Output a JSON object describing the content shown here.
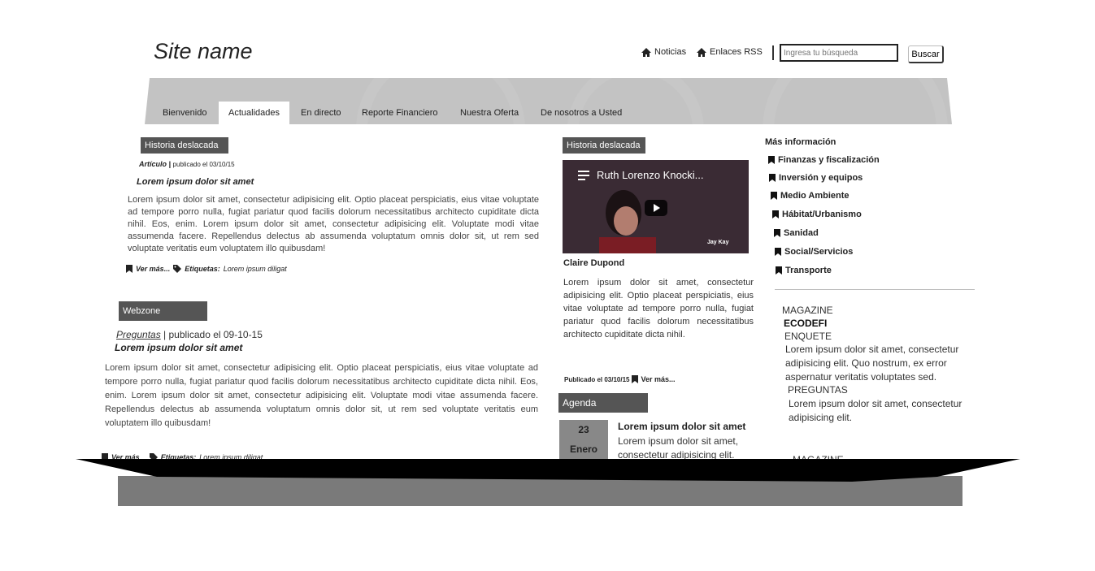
{
  "header": {
    "site_name": "Site name",
    "links": [
      {
        "label": "Noticias",
        "icon": "home-icon"
      },
      {
        "label": "Enlaces RSS",
        "icon": "home-icon"
      }
    ],
    "search": {
      "placeholder": "Ingresa tu búsqueda",
      "button_label": "Buscar"
    }
  },
  "nav": {
    "tabs": [
      {
        "label": "Bienvenido",
        "active": false
      },
      {
        "label": "Actualidades",
        "active": true
      },
      {
        "label": "En directo",
        "active": false
      },
      {
        "label": "Reporte Financiero",
        "active": false
      },
      {
        "label": "Nuestra Oferta",
        "active": false
      },
      {
        "label": "De nosotros a Usted",
        "active": false
      }
    ]
  },
  "featured_left": {
    "label": "Historia deslacada",
    "meta_type": "Artículo |",
    "meta_date": "publicado el 03/10/15",
    "title": "Lorem ipsum dolor sit amet",
    "body": "Lorem ipsum dolor sit amet, consectetur adipisicing elit. Optio placeat perspiciatis, eius vitae voluptate ad tempore porro nulla, fugiat pariatur quod facilis dolorum necessitatibus architecto cupiditate dicta nihil. Eos, enim. Lorem ipsum dolor sit amet, consectetur adipisicing elit. Voluptate modi vitae assumenda facere. Repellendus delectus ab assumenda voluptatum omnis dolor sit, ut rem sed voluptate veritatis eum voluptatem illo quibusdam!",
    "more": "Ver más...",
    "tags_label": "Etiquetas:",
    "tags": "Lorem ipsum diligat"
  },
  "webzone": {
    "label": "Webzone",
    "meta_link": "Preguntas",
    "meta_rest": " | publicado el 09-10-15",
    "title": "Lorem ipsum dolor sit amet",
    "body": "Lorem ipsum dolor sit amet, consectetur adipisicing elit. Optio placeat perspiciatis, eius vitae voluptate ad tempore porro nulla, fugiat pariatur quod facilis dolorum necessitatibus architecto cupiditate dicta nihil. Eos, enim. Lorem ipsum dolor sit amet, consectetur adipisicing elit. Voluptate modi vitae assumenda facere. Repellendus delectus ab assumenda voluptatum omnis dolor sit, ut rem sed voluptate veritatis eum voluptatem illo quibusdam!",
    "more": "Ver más",
    "tags_label": "Etiquetas:",
    "tags": "Lorem ipsum diligat"
  },
  "featured_mid": {
    "label": "Historia deslacada",
    "video_title": "Ruth Lorenzo Knocki...",
    "video_caption": "Jay Kay",
    "author": "Claire Dupond",
    "body": "Lorem ipsum dolor sit amet, consectetur adipisicing elit. Optio placeat perspiciatis, eius vitae voluptate ad tempore porro nulla, fugiat pariatur quod facilis dolorum necessitatibus architecto cupiditate dicta nihil.",
    "footer_date": "Publicado el 03/10/15",
    "more": "Ver más..."
  },
  "agenda": {
    "label": "Agenda",
    "day": "23",
    "month": "Enero",
    "title": "Lorem ipsum dolor sit amet",
    "body": "Lorem ipsum dolor sit amet, consectetur adipisicing elit."
  },
  "sidebar": {
    "heading": "Más información",
    "items": [
      "Finanzas y fiscalización",
      "Inversión y equipos",
      "Medio Ambiente",
      "Hábitat/Urbanismo",
      "Sanidad",
      "Social/Servicios",
      "Transporte"
    ],
    "magazine": "MAGAZINE",
    "brand": "ECODEFI",
    "enquete": "ENQUETE",
    "enquete_text": "Lorem ipsum dolor sit amet, consectetur adipisicing elit. Quo nostrum, ex error aspernatur veritatis voluptates sed.",
    "preguntas": "PREGUNTAS",
    "preguntas_text": "Lorem ipsum dolor sit amet, consectetur adipisicing elit.",
    "magazine2": "MAGAZINE"
  },
  "colors": {
    "label_bg": "#555555",
    "nav_bg": "#c3c3c3",
    "date_bg": "#888888"
  }
}
